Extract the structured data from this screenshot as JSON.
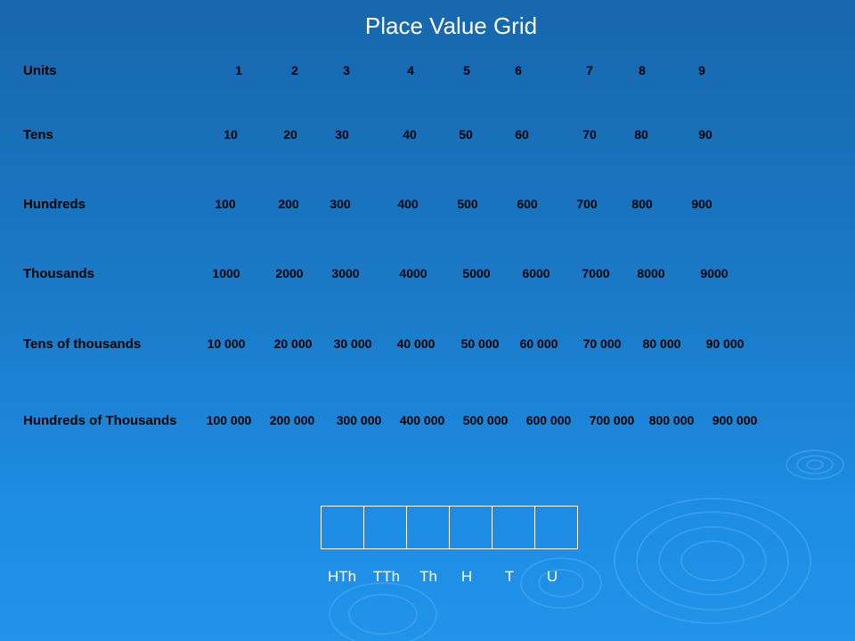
{
  "title": "Place Value Grid",
  "rows": [
    {
      "label": "Units",
      "values": [
        "1",
        "2",
        "3",
        "4",
        "5",
        "6",
        "7",
        "8",
        "9"
      ]
    },
    {
      "label": "Tens",
      "values": [
        "10",
        "20",
        "30",
        "40",
        "50",
        "60",
        "70",
        "80",
        "90"
      ]
    },
    {
      "label": "Hundreds",
      "values": [
        "100",
        "200",
        "300",
        "400",
        "500",
        "600",
        "700",
        "800",
        "900"
      ]
    },
    {
      "label": "Thousands",
      "values": [
        "1000",
        "2000",
        "3000",
        "4000",
        "5000",
        "6000",
        "7000",
        "8000",
        "9000"
      ]
    },
    {
      "label": "Tens of thousands",
      "values": [
        "10 000",
        "20 000",
        "30 000",
        "40 000",
        "50 000",
        "60 000",
        "70 000",
        "80 000",
        "90 000"
      ]
    },
    {
      "label": "Hundreds of Thousands",
      "values": [
        "100 000",
        "200 000",
        "300 000",
        "400 000",
        "500 000",
        "600 000",
        "700 000",
        "800 000",
        "900 000"
      ]
    }
  ],
  "place_value_columns": [
    "HTh",
    "TTh",
    "Th",
    "H",
    "T",
    "U"
  ],
  "colors": {
    "title": "#ffffff",
    "text": "#000000",
    "background": "#1a79c6"
  }
}
